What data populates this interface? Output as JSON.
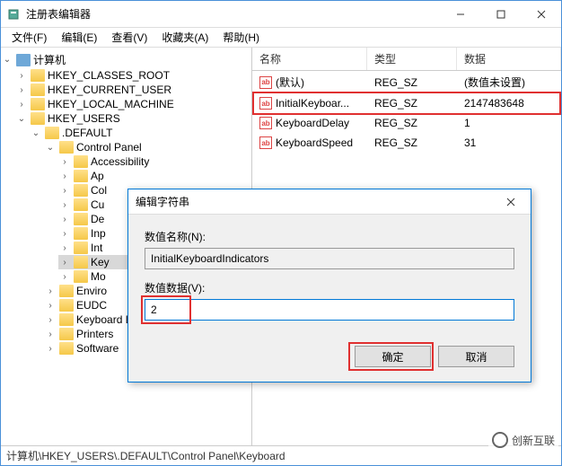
{
  "window": {
    "title": "注册表编辑器",
    "menu": [
      "文件(F)",
      "编辑(E)",
      "查看(V)",
      "收藏夹(A)",
      "帮助(H)"
    ],
    "statusbar": "计算机\\HKEY_USERS\\.DEFAULT\\Control Panel\\Keyboard"
  },
  "tree": {
    "root": "计算机",
    "hives": [
      "HKEY_CLASSES_ROOT",
      "HKEY_CURRENT_USER",
      "HKEY_LOCAL_MACHINE",
      "HKEY_USERS"
    ],
    "default": ".DEFAULT",
    "control_panel": "Control Panel",
    "cp_items": [
      "Accessibility",
      "Ap",
      "Col",
      "Cu",
      "De",
      "Inp",
      "Int",
      "Key",
      "Mo"
    ],
    "after_cp": [
      "Enviro",
      "EUDC",
      "Keyboard Layout",
      "Printers",
      "Software"
    ]
  },
  "list": {
    "headers": {
      "name": "名称",
      "type": "类型",
      "data": "数据"
    },
    "rows": [
      {
        "name": "(默认)",
        "type": "REG_SZ",
        "data": "(数值未设置)"
      },
      {
        "name": "InitialKeyboar...",
        "type": "REG_SZ",
        "data": "2147483648",
        "hl": true
      },
      {
        "name": "KeyboardDelay",
        "type": "REG_SZ",
        "data": "1"
      },
      {
        "name": "KeyboardSpeed",
        "type": "REG_SZ",
        "data": "31"
      }
    ]
  },
  "dialog": {
    "title": "编辑字符串",
    "name_label": "数值名称(N):",
    "name_value": "InitialKeyboardIndicators",
    "data_label": "数值数据(V):",
    "data_value": "2",
    "ok": "确定",
    "cancel": "取消"
  },
  "watermark": "创新互联"
}
